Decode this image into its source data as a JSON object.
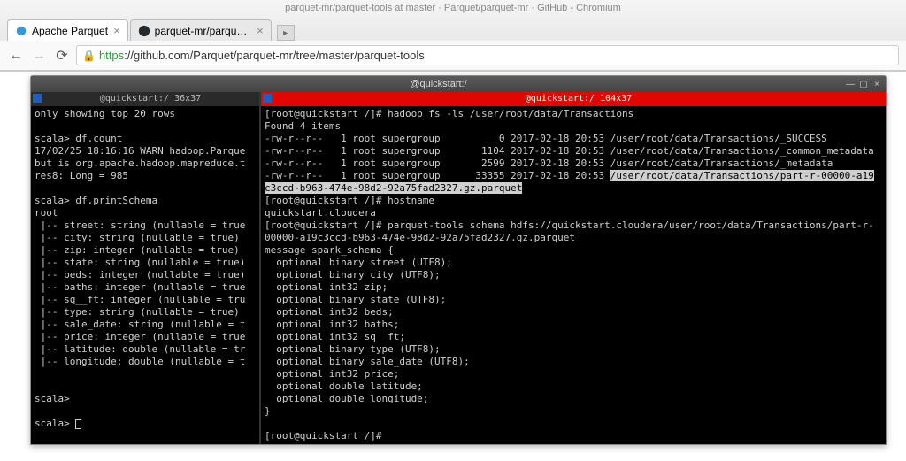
{
  "window": {
    "title": "parquet-mr/parquet-tools at master · Parquet/parquet-mr · GitHub - Chromium"
  },
  "tabs": [
    {
      "label": "Apache Parquet",
      "active": true
    },
    {
      "label": "parquet-mr/parquet-t…",
      "active": false
    }
  ],
  "url": {
    "scheme": "https",
    "rest": "://github.com/Parquet/parquet-mr/tree/master/parquet-tools"
  },
  "terminal": {
    "title": "@quickstart:/",
    "left": {
      "title": "@quickstart:/ 36x37",
      "lines": [
        "only showing top 20 rows",
        "",
        "scala> df.count",
        "17/02/25 18:16:16 WARN hadoop.Parque",
        "but is org.apache.hadoop.mapreduce.t",
        "res8: Long = 985",
        "",
        "scala> df.printSchema",
        "root",
        " |-- street: string (nullable = true",
        " |-- city: string (nullable = true)",
        " |-- zip: integer (nullable = true)",
        " |-- state: string (nullable = true)",
        " |-- beds: integer (nullable = true)",
        " |-- baths: integer (nullable = true",
        " |-- sq__ft: integer (nullable = tru",
        " |-- type: string (nullable = true)",
        " |-- sale_date: string (nullable = t",
        " |-- price: integer (nullable = true",
        " |-- latitude: double (nullable = tr",
        " |-- longitude: double (nullable = t",
        "",
        "",
        "scala>",
        "",
        "scala> "
      ]
    },
    "right": {
      "title": "@quickstart:/ 104x37",
      "cmd1": "[root@quickstart /]# hadoop fs -ls /user/root/data/Transactions",
      "found": "Found 4 items",
      "ls": [
        "-rw-r--r--   1 root supergroup          0 2017-02-18 20:53 /user/root/data/Transactions/_SUCCESS",
        "-rw-r--r--   1 root supergroup       1104 2017-02-18 20:53 /user/root/data/Transactions/_common_metadata",
        "-rw-r--r--   1 root supergroup       2599 2017-02-18 20:53 /user/root/data/Transactions/_metadata"
      ],
      "ls_hl_prefix": "-rw-r--r--   1 root supergroup      33355 2017-02-18 20:53 ",
      "ls_hl_path": "/user/root/data/Transactions/part-r-00000-a19",
      "ls_hl_wrap": "c3ccd-b963-474e-98d2-92a75fad2327.gz.parquet",
      "cmd2": "[root@quickstart /]# hostname",
      "host": "quickstart.cloudera",
      "cmd3a": "[root@quickstart /]# parquet-tools schema hdfs://quickstart.cloudera/user/root/data/Transactions/part-r-",
      "cmd3b": "00000-a19c3ccd-b963-474e-98d2-92a75fad2327.gz.parquet",
      "schema": [
        "message spark_schema {",
        "  optional binary street (UTF8);",
        "  optional binary city (UTF8);",
        "  optional int32 zip;",
        "  optional binary state (UTF8);",
        "  optional int32 beds;",
        "  optional int32 baths;",
        "  optional int32 sq__ft;",
        "  optional binary type (UTF8);",
        "  optional binary sale_date (UTF8);",
        "  optional int32 price;",
        "  optional double latitude;",
        "  optional double longitude;",
        "}"
      ],
      "prompt_end": "[root@quickstart /]# "
    }
  }
}
